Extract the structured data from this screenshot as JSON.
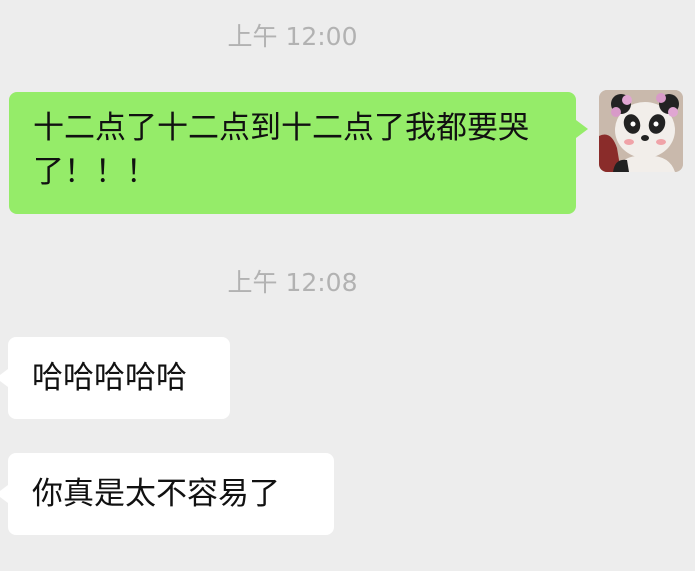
{
  "chat": {
    "timestamps": [
      "上午 12:00",
      "上午 12:08"
    ],
    "messages": [
      {
        "direction": "sent",
        "text": "十二点了十二点到十二点了我都要哭了！！！"
      },
      {
        "direction": "received",
        "text": "哈哈哈哈哈"
      },
      {
        "direction": "received",
        "text": "你真是太不容易了"
      }
    ],
    "avatar_icon": "panda-avatar-icon"
  },
  "colors": {
    "background": "#ededed",
    "sent_bubble": "#95ec69",
    "received_bubble": "#ffffff",
    "timestamp": "#b2b2b2"
  }
}
